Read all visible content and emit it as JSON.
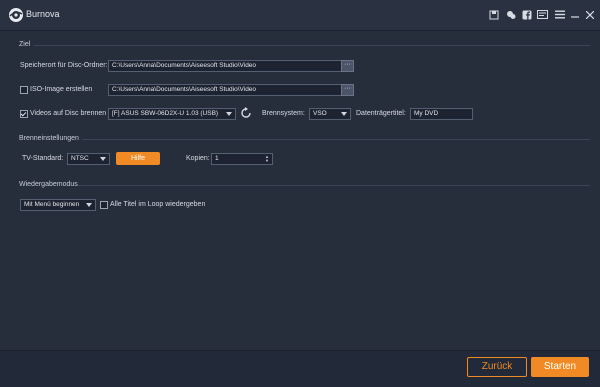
{
  "app": {
    "title": "Burnova",
    "toolbar_icons": [
      "save-icon",
      "chat-icon",
      "facebook-icon",
      "feedback-icon",
      "menu-icon"
    ]
  },
  "ziel": {
    "legend": "Ziel",
    "folder_label": "Speicherort für Disc-Ordner:",
    "folder_path": "C:\\Users\\Anna\\Documents\\Aiseesoft Studio\\Video",
    "iso_label": "ISO-Image erstellen",
    "iso_path": "C:\\Users\\Anna\\Documents\\Aiseesoft Studio\\Video",
    "burn_label": "Videos auf Disc brennen",
    "drive_value": "[F] ASUS SBW-06D2X-U 1.03 (USB)",
    "brennsystem_label": "Brennsystem:",
    "brennsystem_value": "VSO",
    "title_label": "Datenträgertitel:",
    "title_value": "My DVD",
    "browse": "···"
  },
  "brenn": {
    "legend": "Brenneinstellungen",
    "tv_label": "TV-Standard:",
    "tv_value": "NTSC",
    "help_button": "Hilfe",
    "copies_label": "Kopien:",
    "copies_value": "1"
  },
  "wiedergabe": {
    "legend": "Wiedergabemodus",
    "mode_value": "Mit Menü beginnen",
    "loop_label": "Alle Titel im Loop wiedergeben"
  },
  "footer": {
    "back_button": "Zurück",
    "start_button": "Starten"
  },
  "colors": {
    "accent": "#f08a24",
    "background": "#262d3b"
  }
}
